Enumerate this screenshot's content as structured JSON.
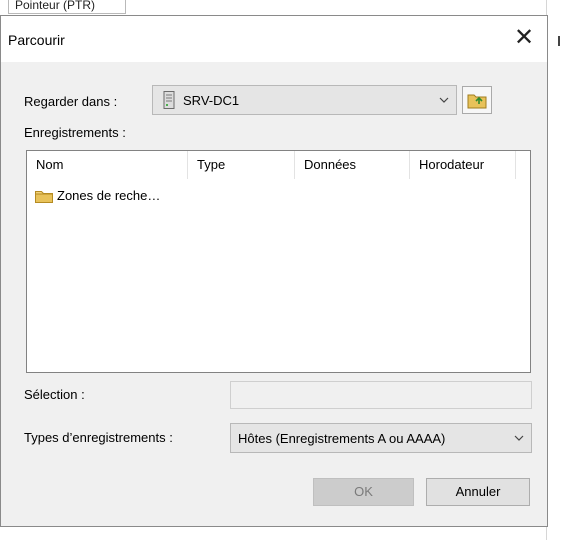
{
  "background": {
    "tab_text": "Pointeur (PTR)"
  },
  "dialog": {
    "title": "Parcourir",
    "close_glyph": "✕"
  },
  "look_in": {
    "label": "Regarder dans :",
    "value": "SRV-DC1",
    "icon": "server-icon",
    "up_icon": "up-folder-icon"
  },
  "records": {
    "label": "Enregistrements :",
    "columns": [
      "Nom",
      "Type",
      "Données",
      "Horodateur"
    ],
    "rows": [
      {
        "icon": "folder-icon",
        "name": "Zones de reche…"
      }
    ]
  },
  "selection": {
    "label": "Sélection :",
    "value": ""
  },
  "record_types": {
    "label": "Types d’enregistrements :",
    "value": "Hôtes (Enregistrements A ou AAAA)"
  },
  "buttons": {
    "ok": "OK",
    "cancel": "Annuler"
  },
  "colors": {
    "dialog_bg": "#f0f0f0",
    "disabled_text": "#7a7a7a",
    "folder": "#e8c25a"
  }
}
